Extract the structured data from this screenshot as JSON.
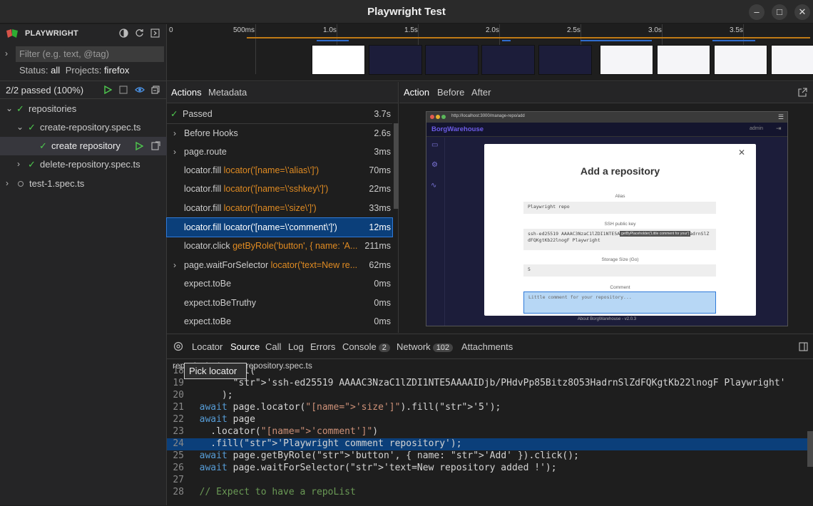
{
  "window": {
    "title": "Playwright Test",
    "minimize": "–",
    "maximize": "□",
    "close": "✕"
  },
  "sidebar": {
    "app_name": "PLAYWRIGHT",
    "filter_placeholder": "Filter (e.g. text, @tag)",
    "status_label": "Status:",
    "status_value": "all",
    "projects_label": "Projects:",
    "projects_value": "firefox",
    "summary": "2/2 passed (100%)",
    "tree": [
      {
        "label": "repositories"
      },
      {
        "label": "create-repository.spec.ts"
      },
      {
        "label": "create repository"
      },
      {
        "label": "delete-repository.spec.ts"
      },
      {
        "label": "test-1.spec.ts"
      }
    ]
  },
  "timeline": {
    "ticks": [
      "0",
      "500ms",
      "1.0s",
      "1.5s",
      "2.0s",
      "2.5s",
      "3.0s",
      "3.5s"
    ]
  },
  "actions_panel": {
    "tabs": [
      "Actions",
      "Metadata"
    ],
    "passed_label": "Passed",
    "passed_time": "3.7s",
    "rows": [
      {
        "name": "Before Hooks",
        "loc": "",
        "time": "2.6s"
      },
      {
        "name": "page.route",
        "loc": "",
        "time": "3ms"
      },
      {
        "name": "locator.fill",
        "loc": "locator('[name=\\'alias\\']')",
        "time": "70ms"
      },
      {
        "name": "locator.fill",
        "loc": "locator('[name=\\'sshkey\\']')",
        "time": "22ms"
      },
      {
        "name": "locator.fill",
        "loc": "locator('[name=\\'size\\']')",
        "time": "33ms"
      },
      {
        "name": "locator.fill",
        "loc": "locator('[name=\\'comment\\']')",
        "time": "12ms"
      },
      {
        "name": "locator.click",
        "loc": "getByRole('button', { name: 'A...",
        "time": "211ms"
      },
      {
        "name": "page.waitForSelector",
        "loc": "locator('text=New re...",
        "time": "62ms"
      },
      {
        "name": "expect.toBe",
        "loc": "",
        "time": "0ms"
      },
      {
        "name": "expect.toBeTruthy",
        "loc": "",
        "time": "0ms"
      },
      {
        "name": "expect.toBe",
        "loc": "",
        "time": "0ms"
      }
    ]
  },
  "snapshot_panel": {
    "tabs": [
      "Action",
      "Before",
      "After"
    ],
    "url": "http://localhost:3000/manage-repo/add",
    "brand": "BorgWarehouse",
    "user": "admin",
    "modal_title": "Add a repository",
    "alias_label": "Alias",
    "alias_value": "Playwright repo",
    "ssh_label": "SSH public key",
    "ssh_value": "ssh-ed25519 AAAAC3NzaC1lZDI1NTE5AAAAIDjb/PHdvPp85Bitz8O53HadrnSlZdFQKgtKb22lnogF Playwright",
    "size_label": "Storage Size (Go)",
    "size_value": "5",
    "comment_label": "Comment",
    "comment_placeholder": "Little comment for your repository...",
    "footer": "About BorgWarehouse - v2.0.3",
    "hint": "getByPlaceholder('Little comment for your')"
  },
  "bottom_panel": {
    "tabs": [
      "Locator",
      "Source",
      "Call",
      "Log",
      "Errors",
      "Console",
      "Network",
      "Attachments"
    ],
    "console_count": "2",
    "network_count": "102",
    "file_name": "repositories/create-repository.spec.ts",
    "tooltip": "Pick locator"
  },
  "code_lines": [
    {
      "n": "18",
      "t": "      .fill("
    },
    {
      "n": "19",
      "t": "        'ssh-ed25519 AAAAC3NzaC1lZDI1NTE5AAAAIDjb/PHdvPp85Bitz8O53HadrnSlZdFQKgtKb22lnogF Playwright'"
    },
    {
      "n": "20",
      "t": "      );"
    },
    {
      "n": "21",
      "t": "  await page.locator(\"[name='size']\").fill('5');"
    },
    {
      "n": "22",
      "t": "  await page"
    },
    {
      "n": "23",
      "t": "    .locator(\"[name='comment']\")"
    },
    {
      "n": "24",
      "t": "    .fill('Playwright comment repository');"
    },
    {
      "n": "25",
      "t": "  await page.getByRole('button', { name: 'Add' }).click();"
    },
    {
      "n": "26",
      "t": "  await page.waitForSelector('text=New repository added !');"
    },
    {
      "n": "27",
      "t": ""
    },
    {
      "n": "28",
      "t": "  // Expect to have a repoList"
    }
  ],
  "colors": {
    "accent": "#2f7ad9",
    "pass": "#4ec94e",
    "locator": "#e08b22",
    "selection": "#0b3f7a"
  }
}
